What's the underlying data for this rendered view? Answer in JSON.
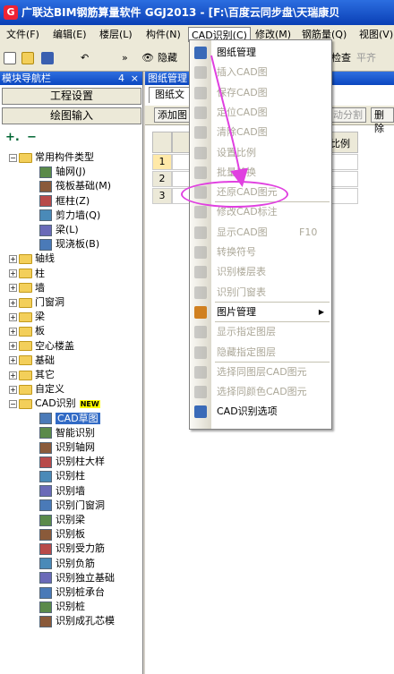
{
  "window": {
    "title": "广联达BIM钢筋算量软件 GGJ2013 - [F:\\百度云同步盘\\天瑞康贝"
  },
  "menubar": [
    "文件(F)",
    "编辑(E)",
    "楼层(L)",
    "构件(N)",
    "CAD识别(C)",
    "修改(M)",
    "钢筋量(Q)",
    "视图(V)"
  ],
  "toolbar": {
    "hide_label": "隐藏",
    "check_label": "检查",
    "flat_label": "平齐",
    "more": "»"
  },
  "nav": {
    "title": "模块导航栏",
    "pin": "4",
    "close": "×",
    "btn_project": "工程设置",
    "btn_draw": "绘图输入",
    "tools": [
      "+.",
      "−"
    ],
    "tree": [
      {
        "label": "常用构件类型",
        "level": 0,
        "expanded": true
      },
      {
        "label": "轴网(J)",
        "level": 1
      },
      {
        "label": "筏板基础(M)",
        "level": 1
      },
      {
        "label": "框柱(Z)",
        "level": 1
      },
      {
        "label": "剪力墙(Q)",
        "level": 1
      },
      {
        "label": "梁(L)",
        "level": 1
      },
      {
        "label": "现浇板(B)",
        "level": 1
      },
      {
        "label": "轴线",
        "level": 0
      },
      {
        "label": "柱",
        "level": 0
      },
      {
        "label": "墙",
        "level": 0
      },
      {
        "label": "门窗洞",
        "level": 0
      },
      {
        "label": "梁",
        "level": 0
      },
      {
        "label": "板",
        "level": 0
      },
      {
        "label": "空心楼盖",
        "level": 0
      },
      {
        "label": "基础",
        "level": 0
      },
      {
        "label": "其它",
        "level": 0
      },
      {
        "label": "自定义",
        "level": 0
      },
      {
        "label": "CAD识别",
        "level": 0,
        "expanded": true,
        "badge": "NEW"
      },
      {
        "label": "CAD草图",
        "level": 1,
        "selected": true
      },
      {
        "label": "智能识别",
        "level": 1
      },
      {
        "label": "识别轴网",
        "level": 1
      },
      {
        "label": "识别柱大样",
        "level": 1
      },
      {
        "label": "识别柱",
        "level": 1
      },
      {
        "label": "识别墙",
        "level": 1
      },
      {
        "label": "识别门窗洞",
        "level": 1
      },
      {
        "label": "识别梁",
        "level": 1
      },
      {
        "label": "识别板",
        "level": 1
      },
      {
        "label": "识别受力筋",
        "level": 1
      },
      {
        "label": "识别负筋",
        "level": 1
      },
      {
        "label": "识别独立基础",
        "level": 1
      },
      {
        "label": "识别桩承台",
        "level": 1
      },
      {
        "label": "识别桩",
        "level": 1
      },
      {
        "label": "识别成孔芯模",
        "level": 1
      }
    ]
  },
  "main": {
    "title": "图纸管理",
    "tab": "图纸文",
    "add_btn": "添加图",
    "split_btn": "动分割",
    "delete_btn": "删除",
    "col_ratio": "比例",
    "rows": [
      "1",
      "2",
      "3"
    ]
  },
  "cad_menu": {
    "items": [
      {
        "label": "图纸管理",
        "disabled": false
      },
      {
        "label": "插入CAD图",
        "disabled": true
      },
      {
        "label": "保存CAD图",
        "disabled": true
      },
      {
        "label": "定位CAD图",
        "disabled": true
      },
      {
        "label": "清除CAD图",
        "disabled": true
      },
      {
        "label": "设置比例",
        "disabled": true
      },
      {
        "label": "批量替换",
        "disabled": true
      },
      {
        "label": "还原CAD图元",
        "disabled": true
      },
      {
        "label": "修改CAD标注",
        "disabled": true
      },
      {
        "label": "显示CAD图",
        "disabled": true,
        "shortcut": "F10"
      },
      {
        "label": "转换符号",
        "disabled": true
      },
      {
        "label": "识别楼层表",
        "disabled": true
      },
      {
        "label": "识别门窗表",
        "disabled": true
      },
      {
        "label": "图片管理",
        "disabled": false,
        "submenu": true
      },
      {
        "label": "显示指定图层",
        "disabled": true
      },
      {
        "label": "隐藏指定图层",
        "disabled": true
      },
      {
        "label": "选择同图层CAD图元",
        "disabled": true
      },
      {
        "label": "选择同颜色CAD图元",
        "disabled": true
      },
      {
        "label": "CAD识别选项",
        "disabled": false
      }
    ]
  },
  "colors": {
    "highlight": "#e040e0",
    "titlebar": "#0a3fb5",
    "selection": "#316ac5"
  }
}
